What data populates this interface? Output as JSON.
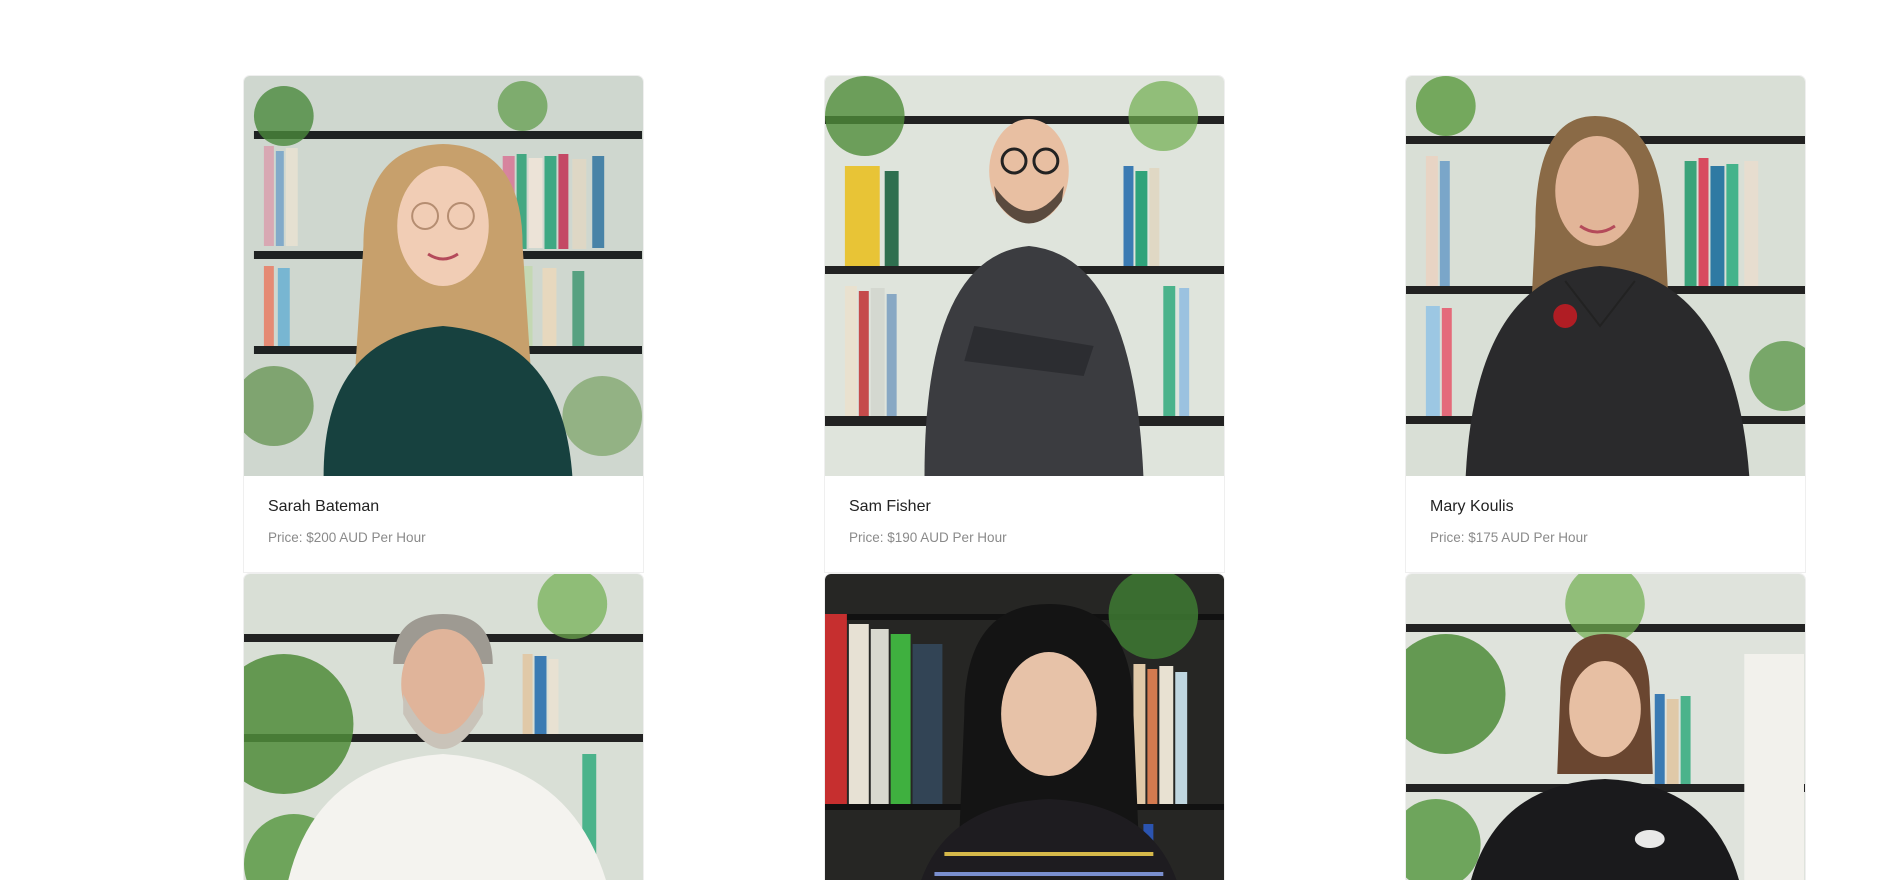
{
  "people": [
    {
      "name": "Sarah Bateman",
      "price": "Price: $200 AUD Per Hour",
      "portrait": "woman-blonde-glasses-portrait"
    },
    {
      "name": "Sam Fisher",
      "price": "Price: $190 AUD Per Hour",
      "portrait": "man-glasses-beard-portrait"
    },
    {
      "name": "Mary Koulis",
      "price": "Price: $175 AUD Per Hour",
      "portrait": "woman-red-necklace-portrait"
    },
    {
      "portrait": "man-grey-beard-portrait"
    },
    {
      "portrait": "woman-dark-hair-portrait"
    },
    {
      "portrait": "woman-polo-shirt-portrait"
    }
  ]
}
